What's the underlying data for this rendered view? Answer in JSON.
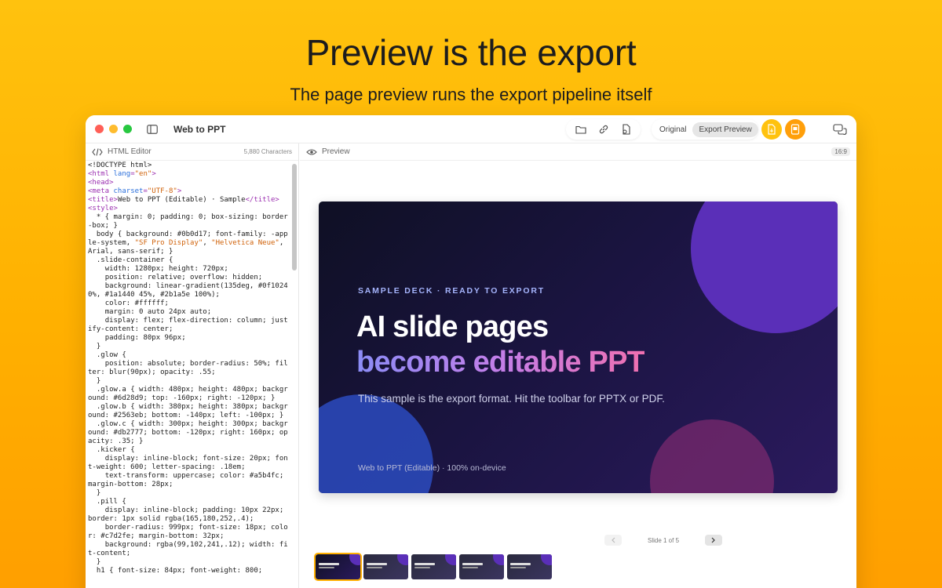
{
  "hero": {
    "title": "Preview is the export",
    "subtitle": "The page preview runs the export pipeline itself"
  },
  "window": {
    "title": "Web to PPT",
    "toolbar": {
      "icons": [
        "folder-icon",
        "link-icon",
        "document-icon"
      ],
      "view_modes": [
        "Original",
        "Export Preview"
      ],
      "active_view": "Export Preview",
      "export_buttons": [
        "export-pptx-icon",
        "export-pdf-icon"
      ],
      "chat_icon": "chat-bubbles-icon"
    }
  },
  "editor": {
    "label": "HTML Editor",
    "char_count": "5,880 Characters"
  },
  "preview": {
    "label": "Preview",
    "aspect": "16:9",
    "slide": {
      "kicker": "SAMPLE DECK · READY TO EXPORT",
      "title_line1": "AI slide pages",
      "title_line2": "become editable PPT",
      "subtitle": "This sample is the export format. Hit the toolbar for PPTX or PDF.",
      "footer": "Web to PPT (Editable) · 100% on-device"
    },
    "pager": {
      "indicator": "Slide 1 of 5"
    },
    "thumbnails_count": 5
  },
  "colors": {
    "background": "#ffb000",
    "accent_orange": "#ff9f0a",
    "accent_yellow": "#ffc20e",
    "slide_bg": "#1a1440",
    "kicker": "#a5b4fc"
  }
}
